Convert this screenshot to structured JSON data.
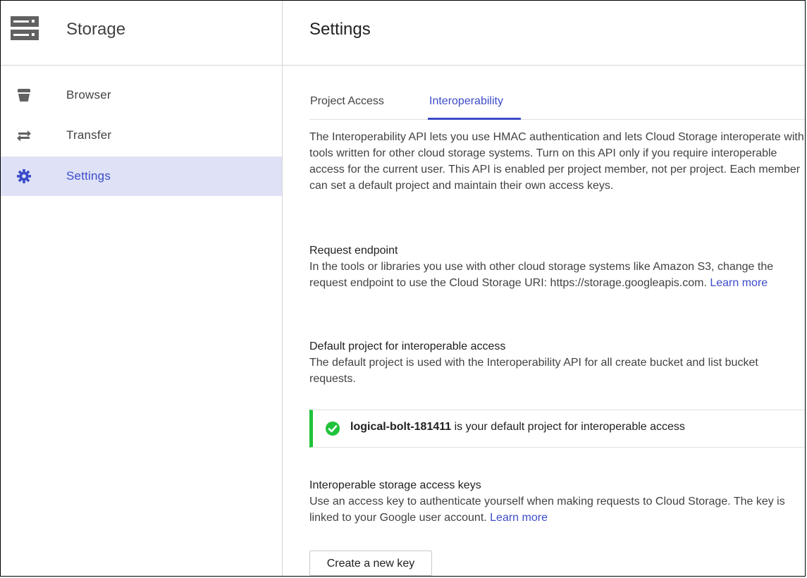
{
  "sidebar": {
    "product_icon": "storage-icon",
    "product_title": "Storage",
    "items": [
      {
        "label": "Browser",
        "icon": "bucket-icon",
        "active": false
      },
      {
        "label": "Transfer",
        "icon": "transfer-arrows-icon",
        "active": false
      },
      {
        "label": "Settings",
        "icon": "gear-icon",
        "active": true
      }
    ]
  },
  "header": {
    "title": "Settings"
  },
  "tabs": [
    {
      "label": "Project Access",
      "active": false
    },
    {
      "label": "Interoperability",
      "active": true
    }
  ],
  "intro": {
    "text": "The Interoperability API lets you use HMAC authentication and lets Cloud Storage interoperate with tools written for other cloud storage systems. Turn on this API only if you require interoperable access for the current user. This API is enabled per project member, not per project. Each member can set a default project and maintain their own access keys."
  },
  "request_endpoint": {
    "title": "Request endpoint",
    "text": "In the tools or libraries you use with other cloud storage systems like Amazon S3, change the request endpoint to use the Cloud Storage URI: https://storage.googleapis.com.",
    "link": "Learn more"
  },
  "default_project": {
    "title": "Default project for interoperable access",
    "text": "The default project is used with the Interoperability API for all create bucket and list bucket requests.",
    "notice_project": "logical-bolt-181411",
    "notice_text": "is your default project for interoperable access"
  },
  "access_keys": {
    "title": "Interoperable storage access keys",
    "text": "Use an access key to authenticate yourself when making requests to Cloud Storage. The key is linked to your Google user account.",
    "link": "Learn more",
    "button": "Create a new key"
  },
  "colors": {
    "accent": "#3b4bc8",
    "active_nav_bg": "#dfe2f7",
    "success": "#20c33a"
  }
}
